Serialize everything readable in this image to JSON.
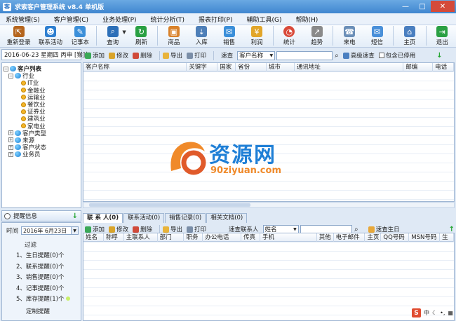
{
  "window": {
    "title": "求索客户管理系统 v8.4 单机版"
  },
  "menu": [
    "系统管理(S)",
    "客户管理(C)",
    "业务处理(P)",
    "统计分析(T)",
    "报表打印(P)",
    "辅助工具(G)",
    "帮助(H)"
  ],
  "toolbar": [
    {
      "label": "重新登录",
      "icon": "relogin-icon",
      "color": "#b5651d"
    },
    {
      "label": "联系活动",
      "icon": "contact-activity-icon",
      "color": "#2e7fd0"
    },
    {
      "label": "记事本",
      "icon": "notebook-icon",
      "color": "#3b8fd9"
    },
    {
      "label": "查询",
      "icon": "search-icon",
      "color": "#2c6fb8"
    },
    {
      "label": "刷新",
      "icon": "refresh-icon",
      "color": "#2aa043"
    },
    {
      "label": "商品",
      "icon": "goods-icon",
      "color": "#d9822b"
    },
    {
      "label": "入库",
      "icon": "stock-in-icon",
      "color": "#4e7fb8"
    },
    {
      "label": "销售",
      "icon": "sales-icon",
      "color": "#3b8fd9"
    },
    {
      "label": "利润",
      "icon": "profit-icon",
      "color": "#e2a62a"
    },
    {
      "label": "统计",
      "icon": "pie-chart-icon",
      "color": "#d94a3a"
    },
    {
      "label": "趋势",
      "icon": "trend-icon",
      "color": "#8a8a8a"
    },
    {
      "label": "来电",
      "icon": "incoming-call-icon",
      "color": "#6b8fb8"
    },
    {
      "label": "短信",
      "icon": "sms-icon",
      "color": "#4a90d9"
    },
    {
      "label": "主页",
      "icon": "home-page-icon",
      "color": "#4a7fc0"
    },
    {
      "label": "退出",
      "icon": "exit-icon",
      "color": "#2aa043"
    }
  ],
  "date_display": "2016-06-23 星期四 丙申 [猴]年",
  "customer_toolbar": {
    "add": "添加",
    "edit": "修改",
    "delete": "删除",
    "export": "导出",
    "print": "打印",
    "query_label": "速查",
    "query_field": "客户名称",
    "advanced": "高级速查",
    "include_disabled": "包含已停用"
  },
  "customer_columns": [
    "客户名称",
    "关键字",
    "国家",
    "省份",
    "城市",
    "通讯地址",
    "邮编",
    "电话"
  ],
  "tree": {
    "root": "客户列表",
    "industry": "行业",
    "industries": [
      "IT业",
      "金融业",
      "运输业",
      "餐饮业",
      "证券业",
      "建筑业",
      "家电业"
    ],
    "groups": [
      "客户类型",
      "来源",
      "客户状态",
      "业务员"
    ]
  },
  "reminder": {
    "header": "提醒信息",
    "time_label": "时间",
    "date": "2016年 6月23日",
    "overdue": "过滤",
    "items": [
      "1、生日提醒(0)个",
      "2、联系提醒(0)个",
      "3、销售提醒(0)个",
      "4、记事提醒(0)个",
      "5、库存提醒(1)个"
    ],
    "custom": "定制提醒"
  },
  "tabs": [
    "联 系 人(0)",
    "联系活动(0)",
    "销售记录(0)",
    "相关文档(0)"
  ],
  "contact_toolbar": {
    "add": "添加",
    "edit": "修改",
    "delete": "删除",
    "export": "导出",
    "print": "打印",
    "query_label": "速查联系人",
    "query_field": "姓名",
    "quick_birthday": "速查生日"
  },
  "contact_columns": [
    "姓名",
    "称呼",
    "主联系人",
    "部门",
    "职务",
    "办公电话",
    "传真",
    "手机",
    "其他",
    "电子邮件",
    "主页",
    "QQ号码",
    "MSN号码",
    "生"
  ],
  "watermark": {
    "main": "资源网",
    "sub": "90ziyuan.com"
  },
  "ime": {
    "label": "中"
  }
}
